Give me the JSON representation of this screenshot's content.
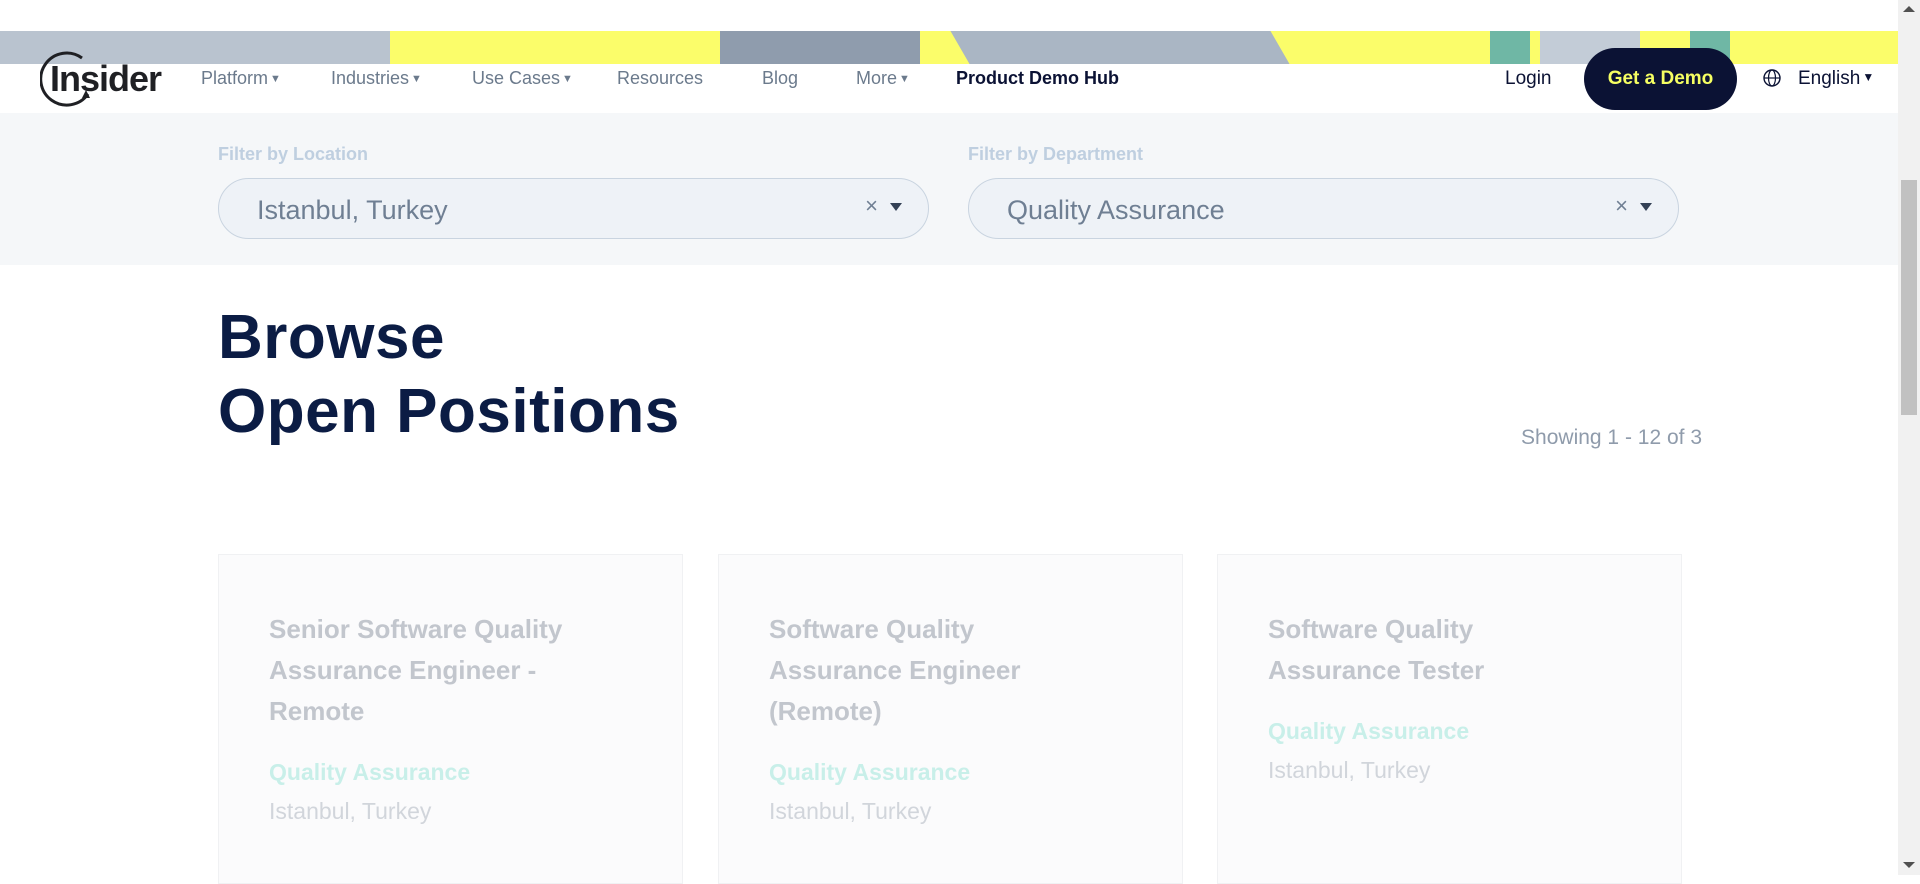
{
  "brand": {
    "logo_text": "Insider"
  },
  "nav": {
    "items": [
      {
        "label": "Platform",
        "caret": true
      },
      {
        "label": "Industries",
        "caret": true
      },
      {
        "label": "Use Cases",
        "caret": true
      },
      {
        "label": "Resources",
        "caret": false
      },
      {
        "label": "Blog",
        "caret": false
      },
      {
        "label": "More",
        "caret": true
      },
      {
        "label": "Product Demo Hub",
        "caret": false
      }
    ],
    "login_label": "Login",
    "demo_label": "Get a Demo",
    "language_label": "English"
  },
  "filters": {
    "location": {
      "label": "Filter by Location",
      "value": "Istanbul, Turkey",
      "clear": "×"
    },
    "department": {
      "label": "Filter by Department",
      "value": "Quality Assurance",
      "clear": "×"
    }
  },
  "heading": {
    "line1": "Browse",
    "line2": "Open Positions"
  },
  "results_text": "Showing 1 - 12 of 3",
  "jobs": [
    {
      "title": "Senior Software Quality Assurance Engineer - Remote",
      "department": "Quality Assurance",
      "location": "Istanbul, Turkey"
    },
    {
      "title": "Software Quality Assurance Engineer (Remote)",
      "department": "Quality Assurance",
      "location": "Istanbul, Turkey"
    },
    {
      "title": "Software Quality Assurance Tester",
      "department": "Quality Assurance",
      "location": "Istanbul, Turkey"
    }
  ],
  "colors": {
    "brand_dark": "#0b1234",
    "accent_yellow": "#f6ff62",
    "teal": "#c8efe9"
  }
}
